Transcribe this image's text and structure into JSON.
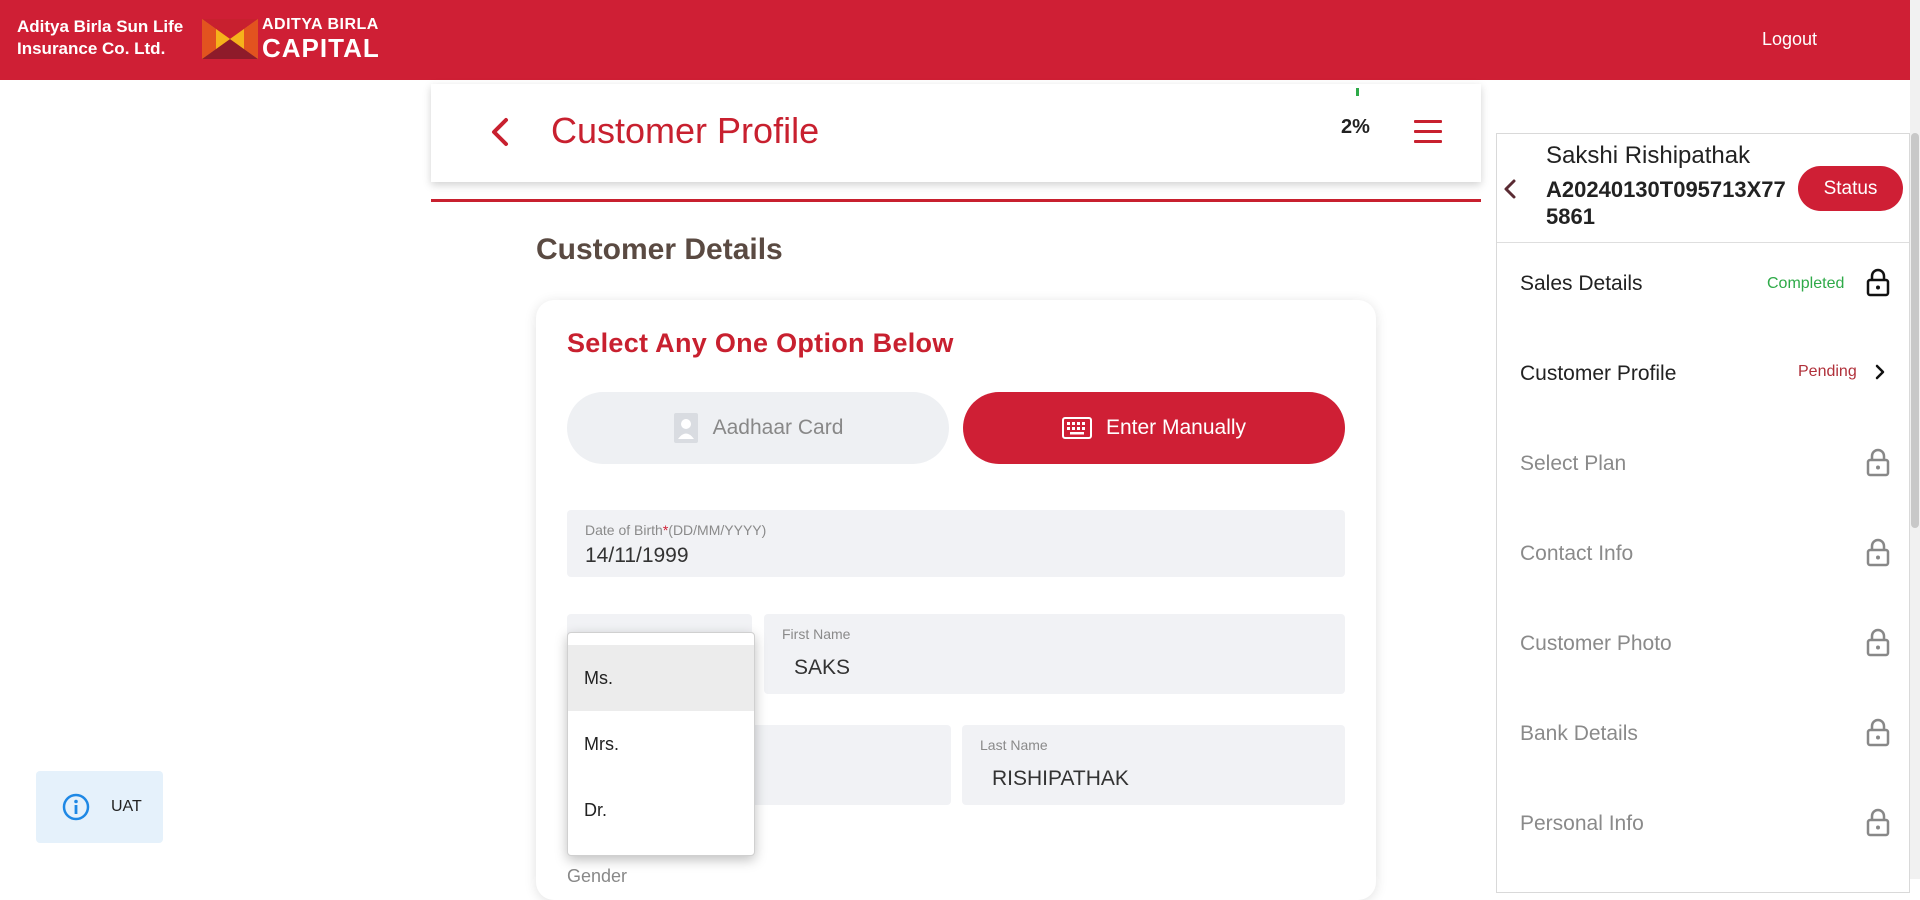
{
  "header": {
    "company_line1": "Aditya Birla Sun Life",
    "company_line2": "Insurance Co. Ltd.",
    "logo_line1": "ADITYA BIRLA",
    "logo_line2": "CAPITAL",
    "logout_label": "Logout"
  },
  "page": {
    "title": "Customer Profile",
    "progress": "2%",
    "section_title": "Customer Details",
    "select_title": "Select Any One Option Below",
    "option_aadhaar": "Aadhaar Card",
    "option_manual": "Enter Manually"
  },
  "form": {
    "dob_label": "Date of Birth",
    "dob_required": "*",
    "dob_format": "(DD/MM/YYYY)",
    "dob_value": "14/11/1999",
    "first_name_label": "First Name",
    "first_name_value": "SAKS",
    "last_name_label": "Last Name",
    "last_name_value": "RISHIPATHAK",
    "gender_label": "Gender"
  },
  "salutation_dropdown": {
    "options": [
      "Ms.",
      "Mrs.",
      "Dr."
    ],
    "highlighted": "Ms."
  },
  "env_badge": {
    "label": "UAT"
  },
  "side_panel": {
    "customer_name": "Sakshi Rishipathak",
    "application_id": "A20240130T095713X775861",
    "status_label": "Status",
    "steps": [
      {
        "label": "Sales Details",
        "status": "Completed",
        "icon": "lock-icon"
      },
      {
        "label": "Customer Profile",
        "status": "Pending",
        "icon": "chevron-right-icon"
      },
      {
        "label": "Select Plan",
        "status": "",
        "icon": "lock-icon"
      },
      {
        "label": "Contact Info",
        "status": "",
        "icon": "lock-icon"
      },
      {
        "label": "Customer Photo",
        "status": "",
        "icon": "lock-icon"
      },
      {
        "label": "Bank Details",
        "status": "",
        "icon": "lock-icon"
      },
      {
        "label": "Personal Info",
        "status": "",
        "icon": "lock-icon"
      }
    ]
  },
  "colors": {
    "brand_red": "#cf1f35",
    "completed_green": "#2eaa48",
    "pending_red": "#b0303a"
  }
}
